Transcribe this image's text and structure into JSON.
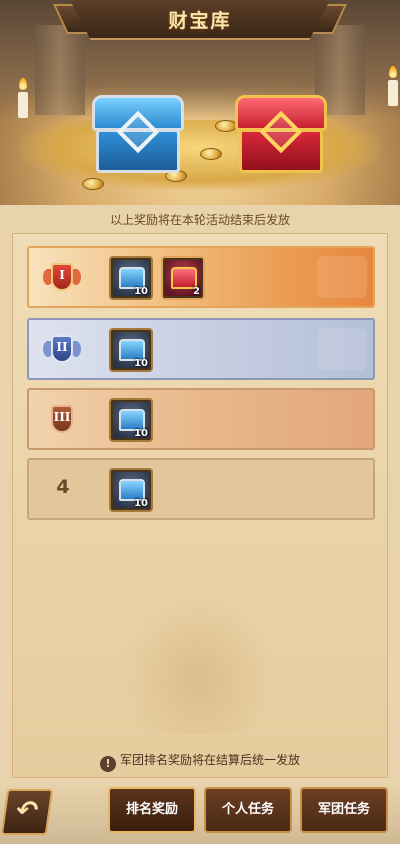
{
  "header": {
    "title": "财宝库"
  },
  "notice": "以上奖励将在本轮活动结束后发放",
  "ranks": [
    {
      "rank": "1",
      "badge_icon": "gold-rank-badge-icon",
      "rewards": [
        {
          "icon": "blue-chest-icon",
          "qty": "10"
        },
        {
          "icon": "red-chest-icon",
          "qty": "2"
        }
      ]
    },
    {
      "rank": "2",
      "badge_icon": "silver-rank-badge-icon",
      "rewards": [
        {
          "icon": "blue-chest-icon",
          "qty": "10"
        }
      ]
    },
    {
      "rank": "3",
      "badge_icon": "bronze-rank-badge-icon",
      "rewards": [
        {
          "icon": "blue-chest-icon",
          "qty": "10"
        }
      ]
    },
    {
      "rank": "4",
      "rank_label": "4",
      "rewards": [
        {
          "icon": "blue-chest-icon",
          "qty": "10"
        }
      ]
    }
  ],
  "footer_note": "军团排名奖励将在结算后统一发放",
  "nav": {
    "back_icon": "back-arrow-icon",
    "tabs": [
      {
        "label": "排名奖励",
        "active": true
      },
      {
        "label": "个人任务",
        "active": false
      },
      {
        "label": "军团任务",
        "active": false
      }
    ]
  },
  "colors": {
    "accent": "#c99048",
    "panel": "#efdcb7",
    "text": "#6a4a2a"
  }
}
